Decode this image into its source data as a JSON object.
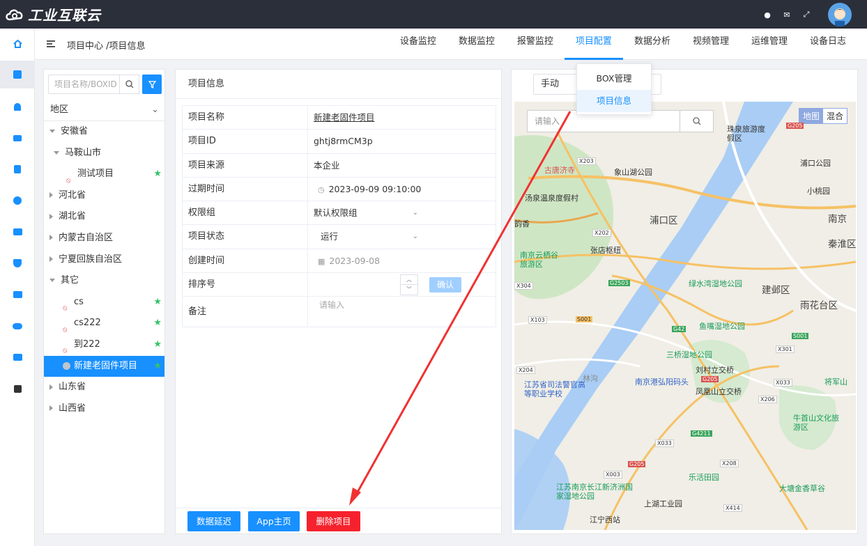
{
  "app": {
    "title": "工业互联云"
  },
  "header": {
    "breadcrumb": "项目中心 /项目信息",
    "tabs": [
      {
        "label": "设备监控"
      },
      {
        "label": "数据监控"
      },
      {
        "label": "报警监控"
      },
      {
        "label": "项目配置"
      },
      {
        "label": "数据分析"
      },
      {
        "label": "视频管理"
      },
      {
        "label": "运维管理"
      },
      {
        "label": "设备日志"
      }
    ],
    "active_tab": "项目配置"
  },
  "dropdown": {
    "items": [
      "BOX管理",
      "项目信息"
    ],
    "selected": "项目信息"
  },
  "left": {
    "search_placeholder": "项目名称/BOXID",
    "region_label": "地区",
    "tree": [
      {
        "label": "安徽省",
        "level": 0,
        "expanded": true
      },
      {
        "label": "马鞍山市",
        "level": 1,
        "expanded": true
      },
      {
        "label": "测试项目",
        "level": 2,
        "project": true,
        "starred": true
      },
      {
        "label": "河北省",
        "level": 0,
        "expanded": false
      },
      {
        "label": "湖北省",
        "level": 0,
        "expanded": false
      },
      {
        "label": "内蒙古自治区",
        "level": 0,
        "expanded": false
      },
      {
        "label": "宁夏回族自治区",
        "level": 0,
        "expanded": false
      },
      {
        "label": "其它",
        "level": 0,
        "expanded": true
      },
      {
        "label": "cs",
        "level": 1,
        "project": true,
        "starred": true
      },
      {
        "label": "cs222",
        "level": 1,
        "project": true,
        "starred": true
      },
      {
        "label": "到222",
        "level": 1,
        "project": true,
        "starred": true
      },
      {
        "label": "新建老固件项目",
        "level": 1,
        "project": true,
        "starred": true,
        "selected": true
      },
      {
        "label": "山东省",
        "level": 0,
        "expanded": false
      },
      {
        "label": "山西省",
        "level": 0,
        "expanded": false
      }
    ]
  },
  "info": {
    "title": "项目信息",
    "fields": {
      "name": {
        "label": "项目名称",
        "value": "新建老固件项目"
      },
      "id": {
        "label": "项目ID",
        "value": "ghtj8rmCM3p"
      },
      "source": {
        "label": "项目来源",
        "value": "本企业"
      },
      "expire": {
        "label": "过期时间",
        "value": "2023-09-09 09:10:00"
      },
      "perm": {
        "label": "权限组",
        "value": "默认权限组"
      },
      "status": {
        "label": "项目状态",
        "value": "运行"
      },
      "created": {
        "label": "创建时间",
        "value": "2023-09-08"
      },
      "sort": {
        "label": "排序号",
        "value": "",
        "confirm": "确认"
      },
      "remark": {
        "label": "备注",
        "placeholder": "请输入"
      }
    },
    "buttons": {
      "delay": "数据延迟",
      "app_home": "App主页",
      "delete": "删除项目"
    }
  },
  "map": {
    "mode": "手动",
    "search_placeholder": "请输入",
    "type_map": "地图",
    "type_hybrid": "混合",
    "labels": [
      "南京",
      "浦口区",
      "建邺区",
      "雨花台区",
      "秦淮区",
      "古唐济寺",
      "象山湖公园",
      "珠泉旅游度假区",
      "浦口公园",
      "小桃园",
      "汤泉温泉度假村",
      "韵香",
      "张店枢纽",
      "南京云栖谷旅游区",
      "绿水湾湿地公园",
      "鱼嘴湿地公园",
      "三桥湿地公园",
      "刘村立交桥",
      "南京港弘阳码头",
      "凤凰山立交桥",
      "江苏省司法警官高等职业学校",
      "将军山",
      "牛首山文化旅游区",
      "乐活田园",
      "江苏南京长江新济洲国家湿地公园",
      "大塘金香草谷",
      "上湖工业园",
      "江宁西站",
      "林沟"
    ],
    "roads": [
      "G205",
      "X203",
      "X202",
      "X304",
      "G2503",
      "X103",
      "S001",
      "G42",
      "X301",
      "S001",
      "X204",
      "G205",
      "X033",
      "X206",
      "G4211",
      "X033",
      "X003",
      "G205",
      "X208",
      "X414"
    ]
  },
  "colors": {
    "primary": "#1890ff",
    "danger": "#f5222d",
    "topbar": "#2b2f3a",
    "star": "#36c36b"
  }
}
